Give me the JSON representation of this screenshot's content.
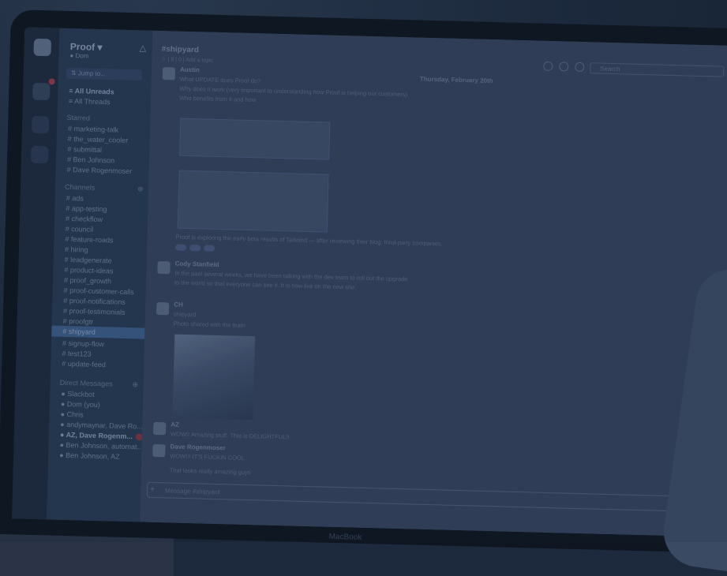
{
  "sidebar": {
    "team_name": "Proof ▾",
    "user_status": "● Dom",
    "jump_to": "⇅ Jump to...",
    "all_unreads": "≡ All Unreads",
    "all_threads": "≡ All Threads",
    "starred_header": "Starred",
    "starred": [
      "# marketing-talk",
      "# the_water_cooler",
      "# submittal",
      "# Ben Johnson",
      "# Dave Rogenmoser"
    ],
    "channels_header": "Channels",
    "channels": [
      "# ads",
      "# app-testing",
      "# checkflow",
      "# council",
      "# feature-roads",
      "# hiring",
      "# leadgenerate",
      "# product-ideas",
      "# proof_growth",
      "# proof-customer-calls",
      "# proof-notifications",
      "# proof-testimonials",
      "# proofgtr",
      "# shipyard",
      "# signup-flow",
      "# test123",
      "# update-feed"
    ],
    "dm_header": "Direct Messages",
    "dms": [
      "● Slackbot",
      "● Dom (you)",
      "● Chris",
      "● andymaynar, Dave Ro...",
      "● AZ, Dave Rogenm...",
      "● Ben Johnson, automat...",
      "● Ben Johnson, AZ"
    ]
  },
  "channel": {
    "name": "#shipyard",
    "meta": "☆ | 8 | 0 | Add a topic",
    "search": "Search",
    "day_divider": "Thursday, February 20th"
  },
  "messages": [
    {
      "author": "Austin",
      "lines": [
        "What UPDATE does Proof do?",
        "Why does it work (very important to understanding how Proof is helping our customers)",
        "Who benefits from it and how"
      ]
    },
    {
      "author": "",
      "lines": [
        "Proof is exploring the early beta results of Tailwind — after reviewing their blog, third-party companies."
      ]
    },
    {
      "author": "Cody Stanfield",
      "lines": [
        "In the past several weeks, we have been talking with the dev team to roll out the upgrade",
        "to the world so that everyone can see it. It is now live on the new site."
      ]
    },
    {
      "author": "CH",
      "lines": [
        "shipyard",
        "Photo shared with the team"
      ]
    },
    {
      "author": "AZ",
      "lines": [
        "WOW!! Amazing stuff. That is DELIGHTFUL!!"
      ]
    },
    {
      "author": "Dave Rogenmoser",
      "lines": [
        "WOW!!! IT'S FUCKIN COOL",
        "That looks really amazing guys"
      ]
    }
  ],
  "composer": {
    "placeholder": "Message #shipyard"
  },
  "brand": "MacBook"
}
